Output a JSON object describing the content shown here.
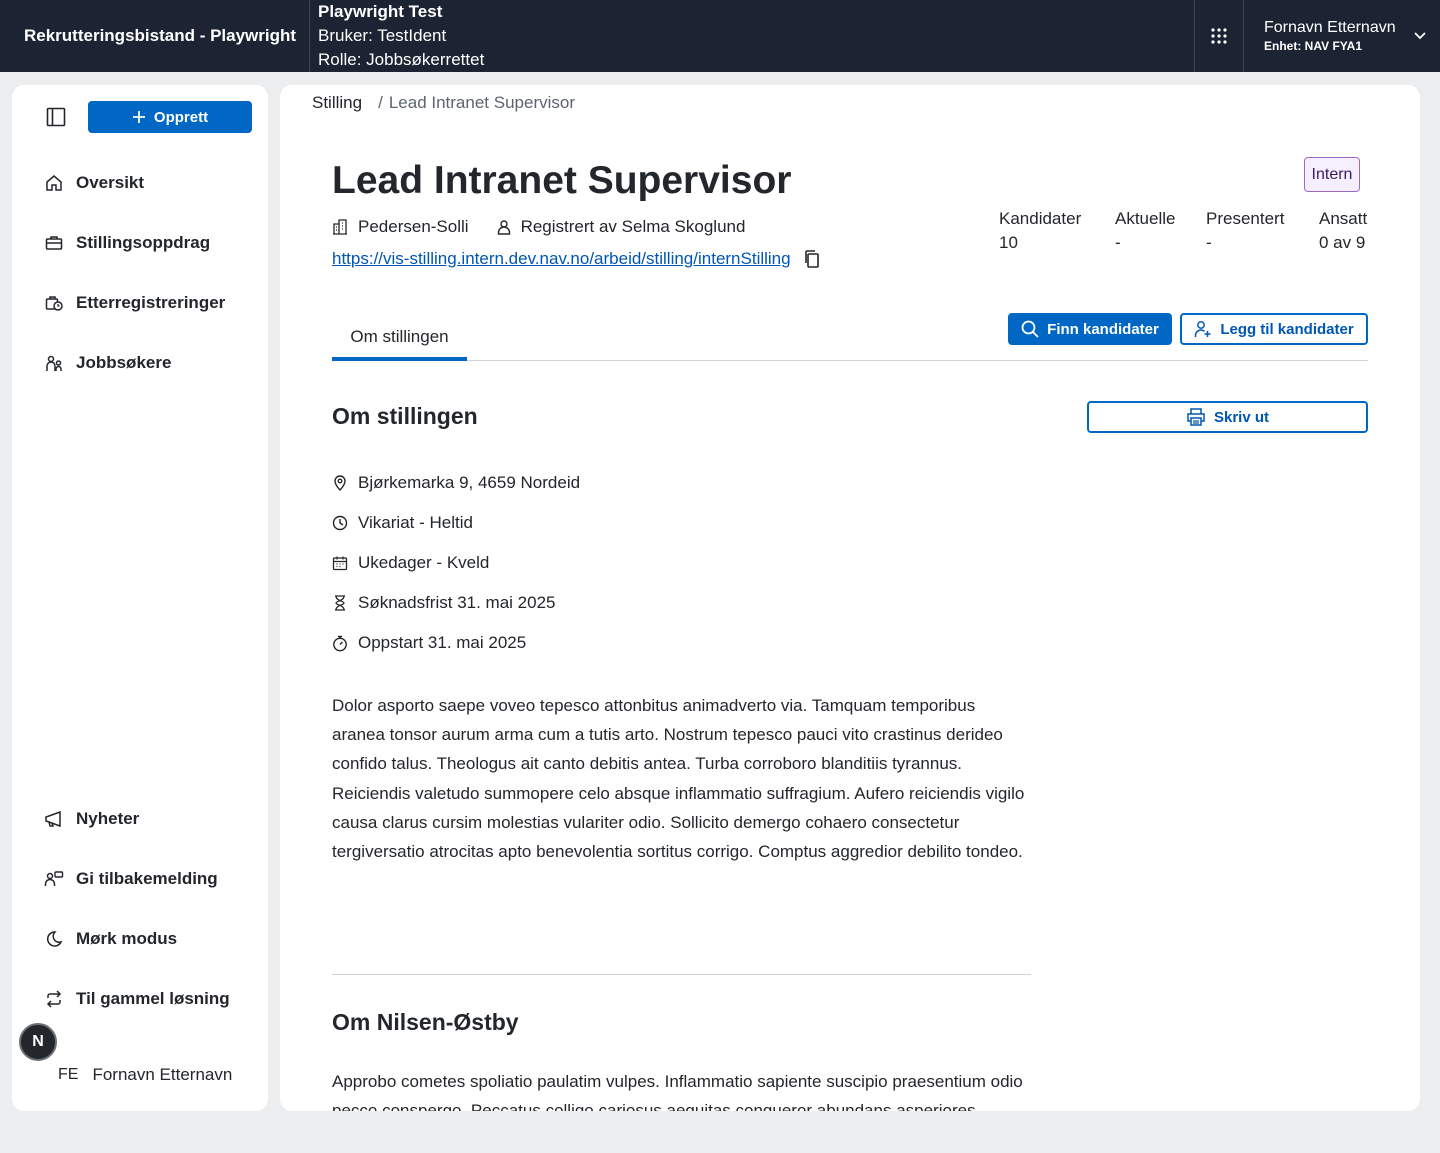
{
  "header": {
    "app_title": "Rekrutteringsbistand - Playwright",
    "test_title": "Playwright Test",
    "test_user": "Bruker: TestIdent",
    "test_role": "Rolle: Jobbsøkerrettet",
    "user_name": "Fornavn Etternavn",
    "user_unit": "Enhet: NAV FYA1"
  },
  "sidebar": {
    "create_label": "Opprett",
    "nav": [
      "Oversikt",
      "Stillingsoppdrag",
      "Etterregistreringer",
      "Jobbsøkere"
    ],
    "bottom": [
      "Nyheter",
      "Gi tilbakemelding",
      "Mørk modus",
      "Til gammel løsning"
    ],
    "badge_letter": "N",
    "user_initials": "FE",
    "user_name": "Fornavn Etternavn"
  },
  "breadcrumb": {
    "root": "Stilling",
    "separator": "/",
    "current": "Lead Intranet Supervisor"
  },
  "job": {
    "title": "Lead Intranet Supervisor",
    "tag": "Intern",
    "employer": "Pedersen-Solli",
    "registered_by": "Registrert av Selma Skoglund",
    "url": "https://vis-stilling.intern.dev.nav.no/arbeid/stilling/internStilling"
  },
  "stats": [
    {
      "label": "Kandidater",
      "value": "10"
    },
    {
      "label": "Aktuelle",
      "value": "-"
    },
    {
      "label": "Presentert",
      "value": "-"
    },
    {
      "label": "Ansatt",
      "value": "0 av 9"
    }
  ],
  "tabs": {
    "active": "Om stillingen"
  },
  "actions": {
    "find_candidates": "Finn kandidater",
    "add_candidates": "Legg til kandidater",
    "print": "Skriv ut"
  },
  "about": {
    "heading": "Om stillingen",
    "address": "Bjørkemarka 9, 4659 Nordeid",
    "employment": "Vikariat - Heltid",
    "schedule": "Ukedager - Kveld",
    "deadline": "Søknadsfrist 31. mai 2025",
    "start": "Oppstart 31. mai 2025",
    "description": "Dolor asporto saepe voveo tepesco attonbitus animadverto via. Tamquam temporibus aranea tonsor aurum arma cum a tutis arto. Nostrum tepesco pauci vito crastinus derideo confido talus. Theologus ait canto debitis antea. Turba corroboro blanditiis tyrannus. Reiciendis valetudo summopere celo absque inflammatio suffragium. Aufero reiciendis vigilo causa clarus cursim molestias vulariter odio. Sollicito demergo cohaero consectetur tergiversatio atrocitas apto benevolentia sortitus corrigo. Comptus aggredior debilito tondeo."
  },
  "employer_section": {
    "heading": "Om Nilsen-Østby",
    "description": "Approbo cometes spoliatio paulatim vulpes. Inflammatio sapiente suscipio praesentium odio pecco conspergo. Peccatus colligo cariosus aequitas congueror abundans asperiores"
  },
  "colors": {
    "header_bg": "#1c2433",
    "accent": "#0067c5",
    "tag_bg": "#f6efff",
    "tag_border": "#9b6ac9"
  }
}
